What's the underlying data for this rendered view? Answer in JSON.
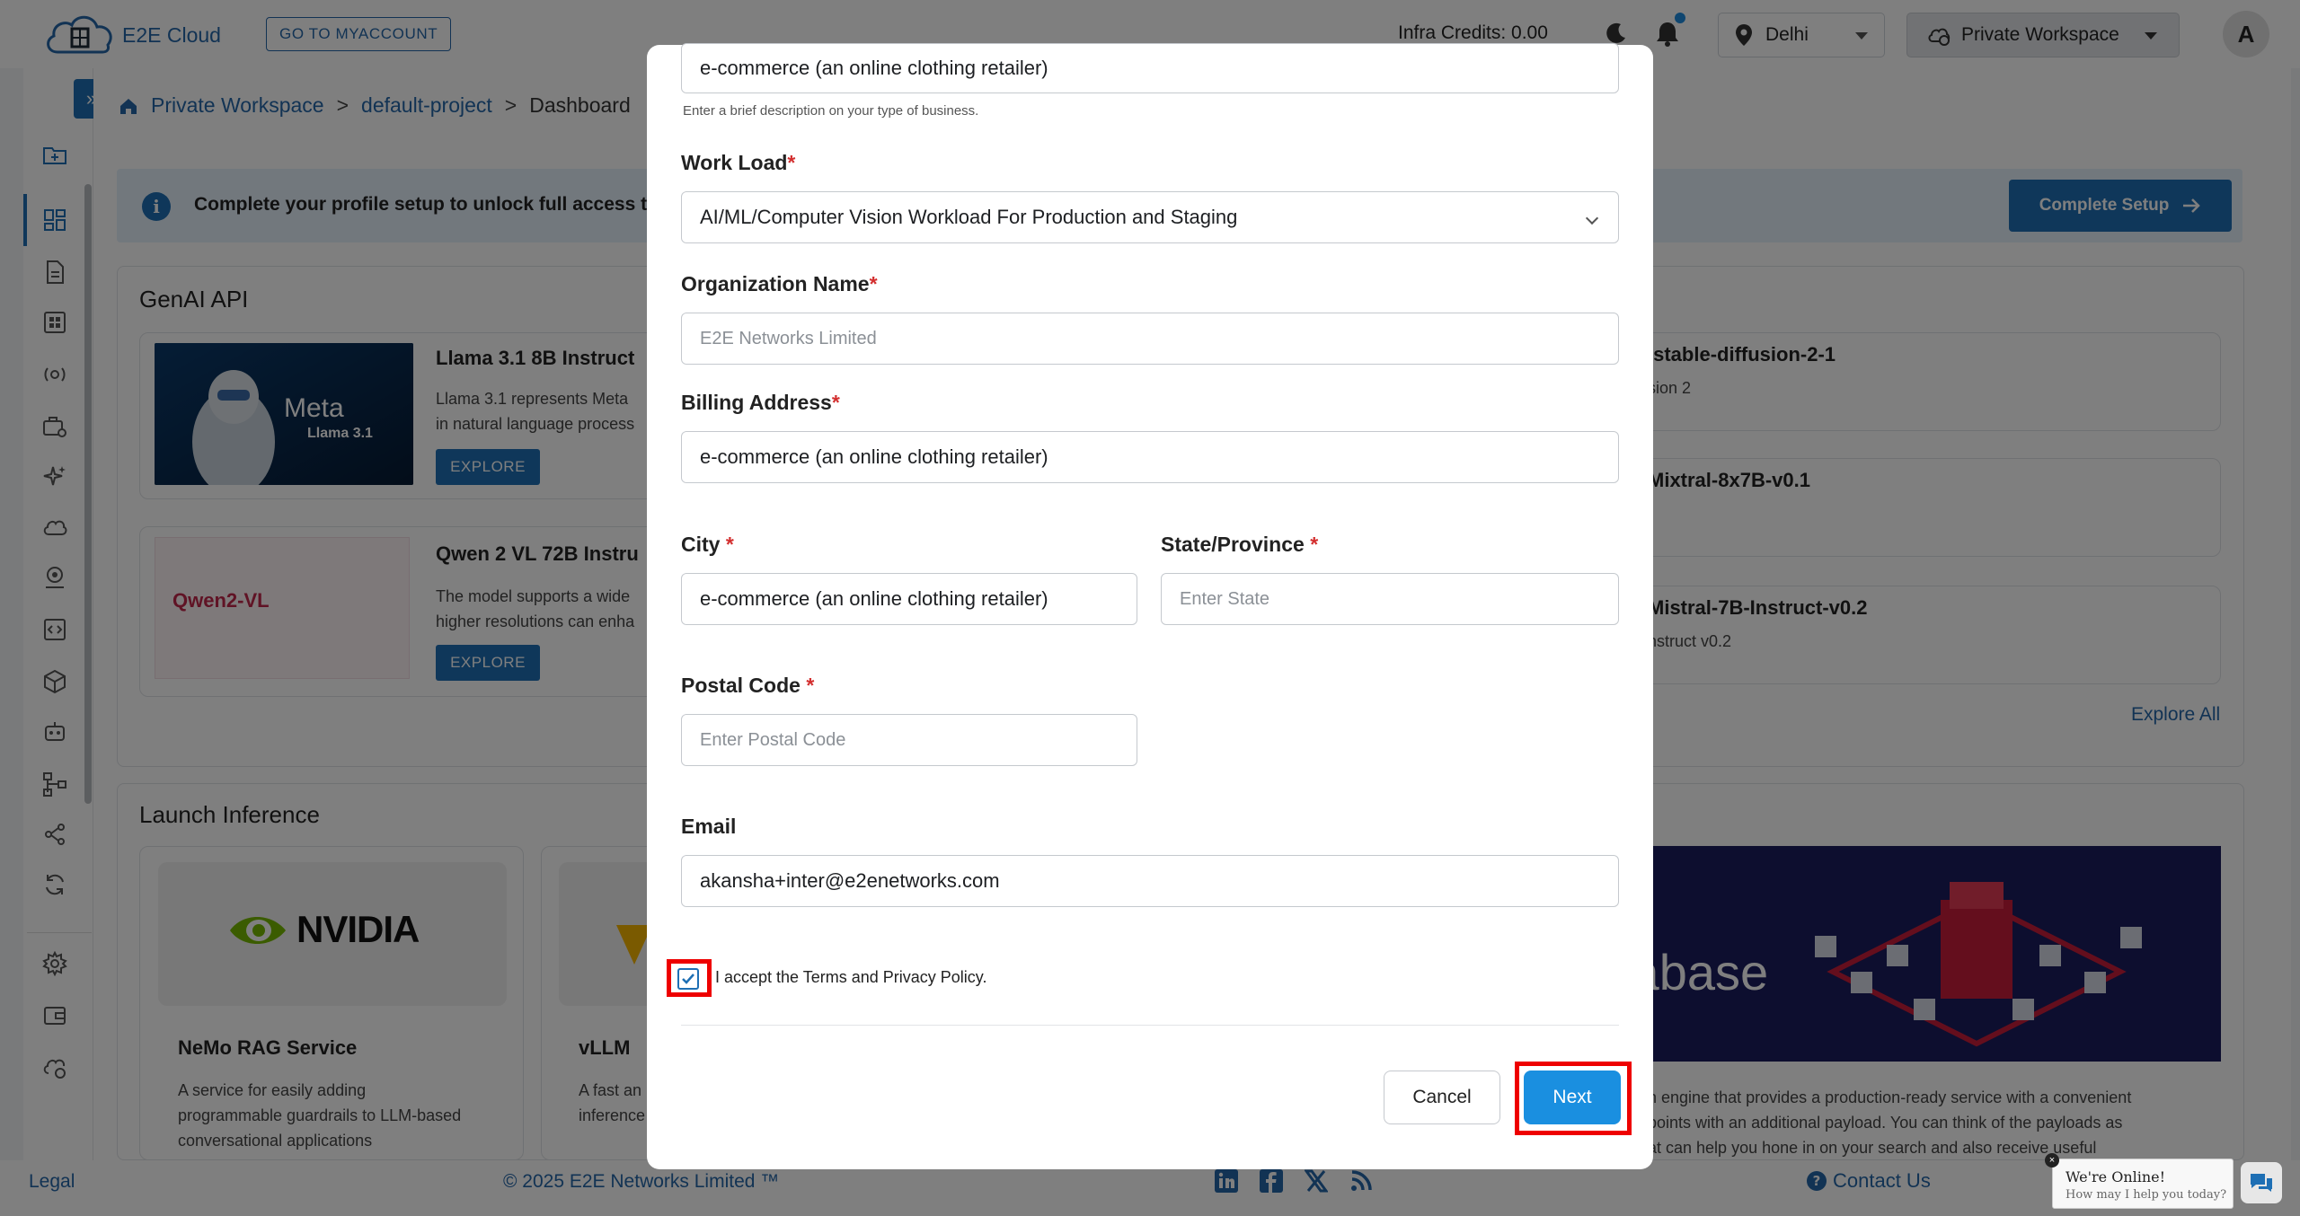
{
  "header": {
    "logo_text": "E2E Cloud",
    "myaccount_label": "GO TO MYACCOUNT",
    "infra_credits": "Infra Credits:  0.00",
    "region": "Delhi",
    "workspace": "Private Workspace",
    "avatar_initial": "A"
  },
  "breadcrumb": {
    "items": [
      "Private Workspace",
      "default-project",
      "Dashboard"
    ],
    "separator": ">"
  },
  "banner": {
    "text": "Complete your profile setup to unlock full access to t",
    "button": "Complete Setup"
  },
  "genai": {
    "title": "GenAI API",
    "cards": [
      {
        "title": "Llama 3.1 8B Instruct",
        "desc_line1": "Llama 3.1 represents Meta",
        "desc_line2": "in natural language process",
        "button": "EXPLORE",
        "image_brand": "Meta",
        "image_sub": "Llama 3.1"
      },
      {
        "title": "Qwen 2 VL 72B Instru",
        "desc_line1": "The model supports a wide",
        "desc_line2": "higher resolutions can enha",
        "button": "EXPLORE",
        "image_brand": "Qwen2-VL"
      }
    ],
    "right_cards": [
      {
        "title": "/stable-diffusion-2-1",
        "desc": "sion 2"
      },
      {
        "title": "Mixtral-8x7B-v0.1",
        "desc": ""
      },
      {
        "title": "Mistral-7B-Instruct-v0.2",
        "desc": "nstruct v0.2"
      }
    ],
    "explore_all": "Explore All"
  },
  "inference": {
    "title": "Launch Inference",
    "cards": [
      {
        "title": "NeMo RAG Service",
        "logo": "NVIDIA",
        "desc": [
          "A service for easily adding",
          "programmable guardrails to LLM-based",
          "conversational applications"
        ]
      },
      {
        "title": "vLLM",
        "desc": [
          "A fast an",
          "inference"
        ]
      }
    ],
    "right_desc": [
      "n engine that provides a production-ready service with a convenient",
      "points with an additional payload. You can think of the payloads as",
      "at can help you hone in on your search and also receive useful"
    ],
    "right_banner_text": "tabase"
  },
  "modal": {
    "description_value": "e-commerce (an online clothing retailer)",
    "description_help": "Enter a brief description on your type of business.",
    "workload_label": "Work Load",
    "workload_value": "AI/ML/Computer Vision Workload For Production and Staging",
    "org_label": "Organization Name",
    "org_placeholder": "E2E Networks Limited",
    "billing_label": "Billing Address",
    "billing_value": "e-commerce (an online clothing retailer)",
    "city_label": "City",
    "city_value": "e-commerce (an online clothing retailer)",
    "state_label": "State/Province",
    "state_placeholder": "Enter State",
    "postal_label": "Postal Code",
    "postal_placeholder": "Enter Postal Code",
    "email_label": "Email",
    "email_value": "akansha+inter@e2enetworks.com",
    "terms_text": "I accept the Terms and Privacy Policy.",
    "terms_checked": true,
    "cancel": "Cancel",
    "next": "Next",
    "required_mark": "*"
  },
  "footer": {
    "legal": "Legal",
    "copyright": "© 2025 E2E Networks Limited ™",
    "contact": "Contact Us",
    "chat_title": "We're Online!",
    "chat_sub": "How may I help you today?",
    "chat_close": "×"
  },
  "colors": {
    "primary": "#1e6fb4",
    "next_button": "#1a8fe0",
    "highlight": "#e00000",
    "required": "#d32f2f"
  }
}
